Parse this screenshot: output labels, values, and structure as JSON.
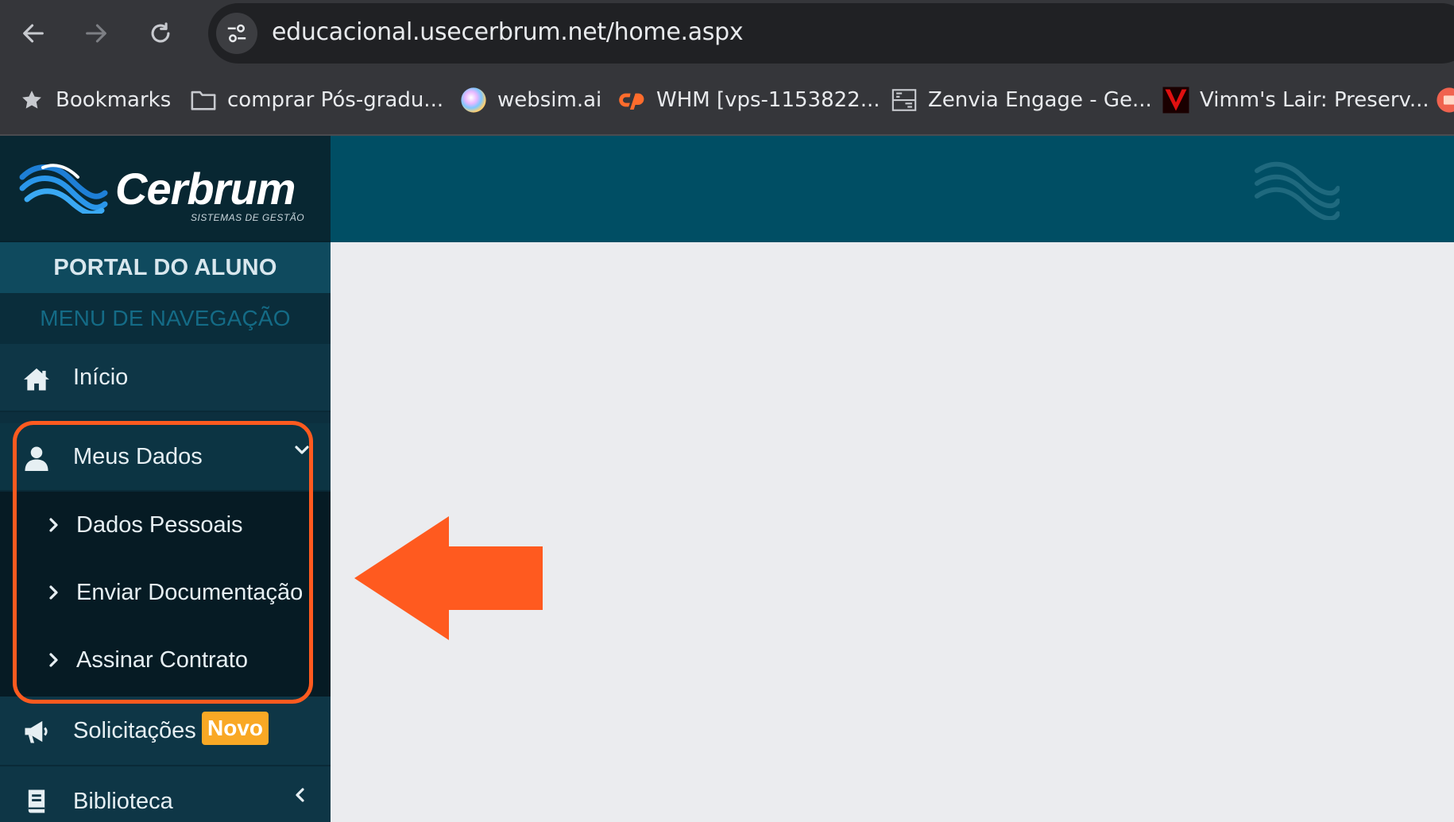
{
  "browser": {
    "url": "educacional.usecerbrum.net/home.aspx",
    "bookmarks": [
      {
        "label": "Bookmarks",
        "icon": "star-icon"
      },
      {
        "label": "comprar Pós-gradu...",
        "icon": "folder-icon"
      },
      {
        "label": "websim.ai",
        "icon": "websim-icon"
      },
      {
        "label": "WHM [vps-1153822...",
        "icon": "cpanel-icon"
      },
      {
        "label": "Zenvia Engage - Ge...",
        "icon": "zenvia-icon"
      },
      {
        "label": "Vimm's Lair: Preserv...",
        "icon": "vimm-icon"
      }
    ]
  },
  "brand": {
    "name": "Cerbrum",
    "tagline": "SISTEMAS DE GESTÃO"
  },
  "sidebar": {
    "portal_title": "PORTAL DO ALUNO",
    "menu_header": "MENU DE NAVEGAÇÃO",
    "items": [
      {
        "label": "Início",
        "icon": "home-icon"
      },
      {
        "label": "Meus Dados",
        "icon": "user-icon",
        "expanded": true,
        "subitems": [
          {
            "label": "Dados Pessoais"
          },
          {
            "label": "Enviar Documentação"
          },
          {
            "label": "Assinar Contrato"
          }
        ]
      },
      {
        "label": "Solicitações",
        "icon": "megaphone-icon",
        "badge": "Novo"
      },
      {
        "label": "Biblioteca",
        "icon": "book-icon"
      }
    ]
  },
  "colors": {
    "header": "#004e64",
    "sidebar": "#0c2f3e",
    "highlight": "#ff5a1f",
    "badge": "#f9a825",
    "content_bg": "#ebecef"
  }
}
